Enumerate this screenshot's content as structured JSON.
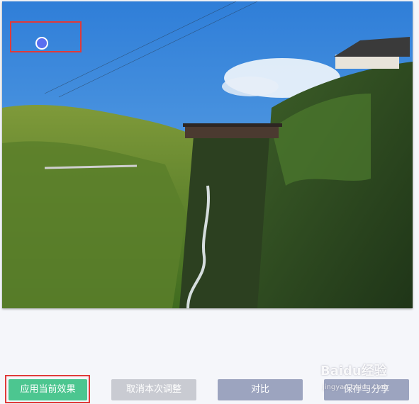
{
  "toolbar": {
    "apply_label": "应用当前效果",
    "cancel_label": "取消本次调整",
    "compare_label": "对比",
    "save_share_label": "保存与分享"
  },
  "colors": {
    "apply": "#4cc690",
    "cancel": "#c9cbd2",
    "compare": "#9ca4bf",
    "save": "#9ca4bf",
    "highlight": "#e03a3a"
  },
  "watermark": {
    "brand": "Baidu经验",
    "url": "jingyan.baidu.com"
  }
}
